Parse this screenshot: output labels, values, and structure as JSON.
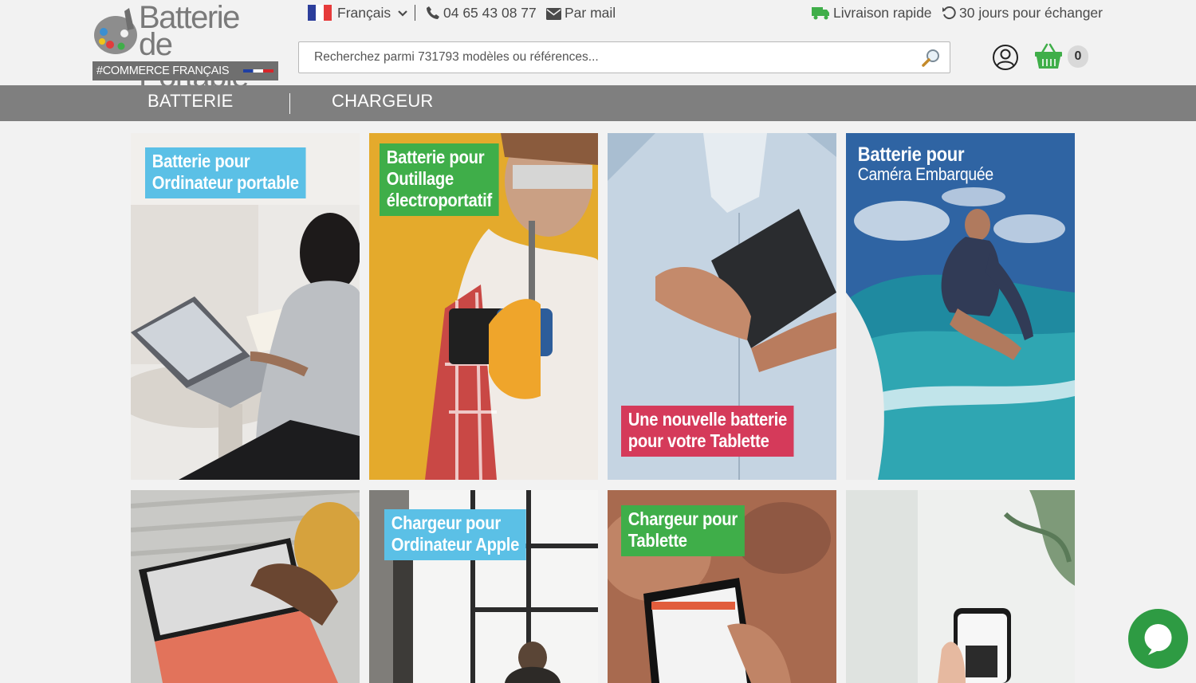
{
  "brand": {
    "line1": "Batterie",
    "line2": "de Portable",
    "tagline": "#COMMERCE FRANÇAIS"
  },
  "topbar": {
    "language": "Français",
    "phone": "04 65 43 08 77",
    "mail": "Par mail",
    "shipping": "Livraison rapide",
    "returns": "30 jours pour échanger"
  },
  "search": {
    "placeholder": "Recherchez parmi 731793 modèles ou références..."
  },
  "cart": {
    "count": "0"
  },
  "nav": {
    "items": [
      {
        "label": "BATTERIE"
      },
      {
        "label": "CHARGEUR"
      }
    ]
  },
  "tiles": [
    {
      "lines": [
        "Batterie pour",
        "Ordinateur portable"
      ],
      "color": "#5bc0e6"
    },
    {
      "lines": [
        "Batterie pour",
        "Outillage",
        "électroportatif"
      ],
      "color": "#3fae49"
    },
    {
      "lines": [
        "Une nouvelle batterie",
        "pour votre Tablette"
      ],
      "color": "#d53a5a"
    },
    {
      "lines": [
        "Batterie pour",
        "Caméra Embarquée"
      ],
      "color": "#ffffff"
    },
    {
      "lines": [],
      "color": ""
    },
    {
      "lines": [
        "Chargeur pour",
        "Ordinateur Apple"
      ],
      "color": "#5bc0e6"
    },
    {
      "lines": [
        "Chargeur pour",
        "Tablette"
      ],
      "color": "#3fae49"
    },
    {
      "lines": [],
      "color": ""
    }
  ],
  "colors": {
    "nav_bg": "#7f7f7f",
    "chat": "#2e9b43",
    "cart": "#3fae49"
  }
}
